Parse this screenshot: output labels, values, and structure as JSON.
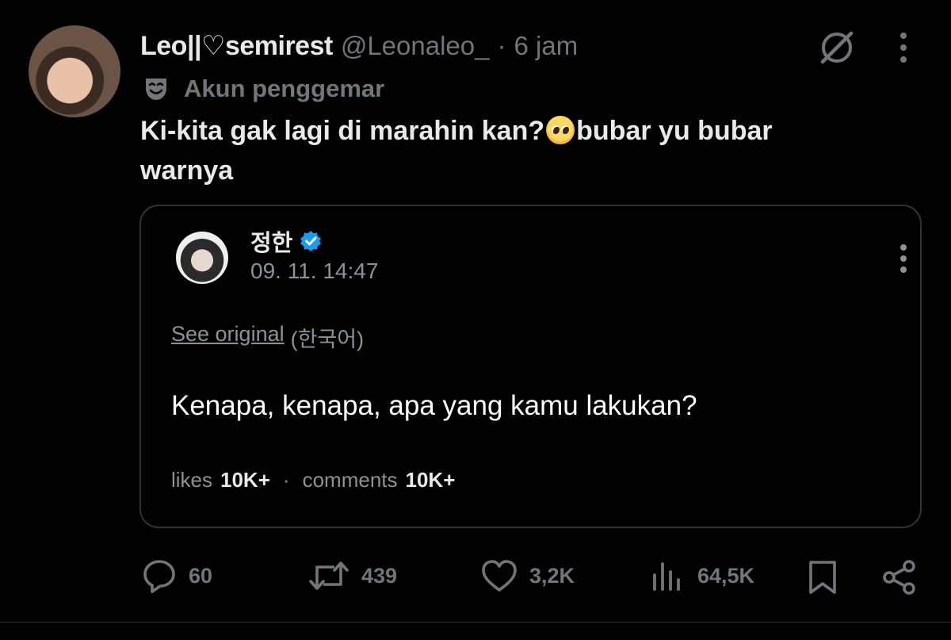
{
  "post": {
    "display_name": "Leo||♡semirest",
    "handle": "@Leonaleo_",
    "separator": "·",
    "time": "6 jam",
    "badge_label": "Akun penggemar",
    "text_part1": "Ki-kita gak lagi di marahin kan?",
    "emoji": "pleading-face-emoji",
    "text_part2": "bubar yu bubar warnya"
  },
  "quote": {
    "name": "정한",
    "verified": true,
    "time": "09. 11. 14:47",
    "see_original": "See original",
    "language": "(한국어)",
    "text": "Kenapa, kenapa, apa yang kamu lakukan?",
    "likes_label": "likes",
    "likes_value": "10K+",
    "separator": "·",
    "comments_label": "comments",
    "comments_value": "10K+"
  },
  "actions": {
    "reply_count": "60",
    "retweet_count": "439",
    "like_count": "3,2K",
    "views_count": "64,5K"
  },
  "colors": {
    "background": "#000000",
    "primary_text": "#e7e9ea",
    "secondary_text": "#71767b",
    "border": "#2f3336",
    "verified": "#1d9bf0"
  }
}
